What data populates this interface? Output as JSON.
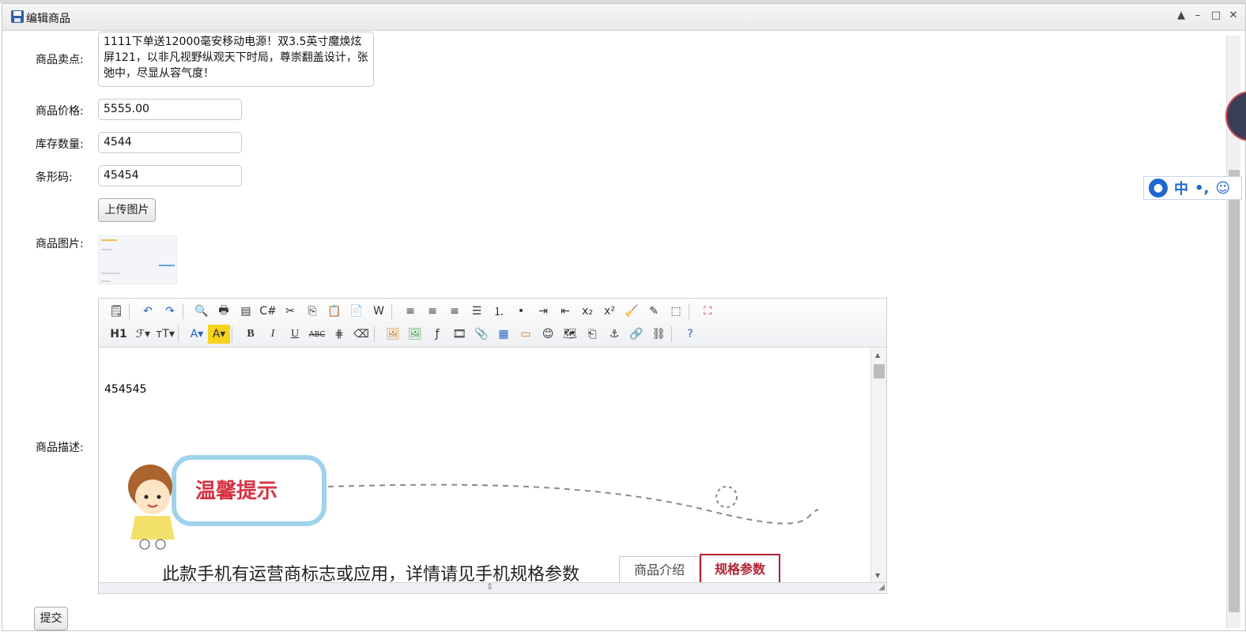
{
  "window": {
    "title": "编辑商品",
    "controls": [
      "▲",
      "–",
      "□",
      "✕"
    ]
  },
  "form": {
    "selling_point": {
      "label": "商品卖点:",
      "value": "1111下单送12000毫安移动电源！双3.5英寸魔焕炫屏121，以非凡视野纵观天下时局，尊崇翻盖设计，张弛中，尽显从容气度！"
    },
    "price": {
      "label": "商品价格:",
      "value": "5555.00"
    },
    "stock": {
      "label": "库存数量:",
      "value": "4544"
    },
    "barcode": {
      "label": "条形码:",
      "value": "45454"
    },
    "upload_label": "上传图片",
    "image": {
      "label": "商品图片:"
    },
    "description": {
      "label": "商品描述:"
    },
    "submit_label": "提交"
  },
  "editor": {
    "toolbar_row1": [
      "source",
      "undo",
      "redo",
      "preview",
      "print",
      "template",
      "code",
      "cut",
      "copy",
      "paste",
      "paste-text",
      "paste-word",
      "align-left",
      "align-center",
      "align-right",
      "justify",
      "ordered-list",
      "unordered-list",
      "indent",
      "outdent",
      "subscript",
      "superscript",
      "clear-format",
      "quick-format",
      "select-all",
      "fullscreen"
    ],
    "toolbar_row2": [
      "heading",
      "font-family",
      "font-size",
      "font-color",
      "highlight-color",
      "bold",
      "italic",
      "underline",
      "strikethrough",
      "line-height",
      "remove-format",
      "image",
      "multi-image",
      "flash",
      "media",
      "attachment",
      "table",
      "hr",
      "emoticon",
      "baidu-map",
      "page-break",
      "anchor",
      "link",
      "unlink",
      "help"
    ],
    "heading_glyph": "H1",
    "body_text": "454545",
    "banner": {
      "tip_title": "温馨提示",
      "tip_text": "此款手机有运营商标志或应用，详情请见手机规格参数",
      "tab_intro": "商品介绍",
      "tab_specs": "规格参数"
    }
  },
  "ime": {
    "lang": "中",
    "punct": "•,",
    "emoji": "☺"
  },
  "colors": {
    "accent": "#1e66d0",
    "tip_red": "#d63343"
  }
}
